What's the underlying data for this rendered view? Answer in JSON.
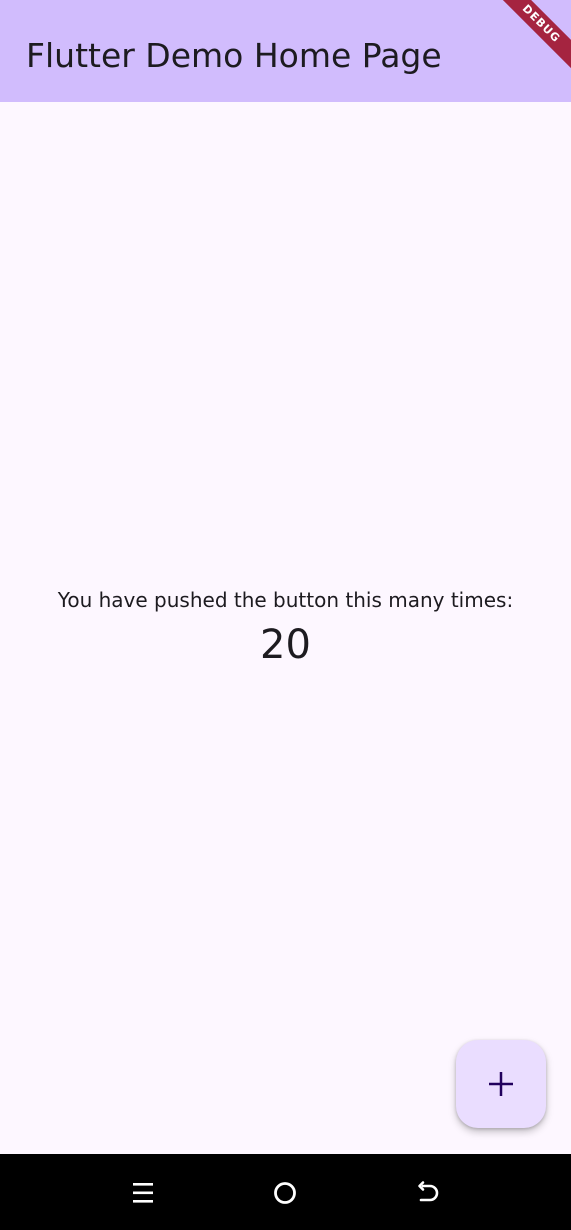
{
  "app_bar": {
    "title": "Flutter Demo Home Page",
    "background": "#d1bcfd"
  },
  "debug_banner": {
    "text": "DEBUG",
    "color": "#a52440"
  },
  "main": {
    "counter_label": "You have pushed the button this many times:",
    "counter_value": "20"
  },
  "fab": {
    "icon": "add-icon",
    "background": "#eaddff"
  },
  "system_nav": {
    "buttons": [
      {
        "icon": "recent-apps-icon"
      },
      {
        "icon": "home-circle-icon"
      },
      {
        "icon": "back-icon"
      }
    ]
  }
}
